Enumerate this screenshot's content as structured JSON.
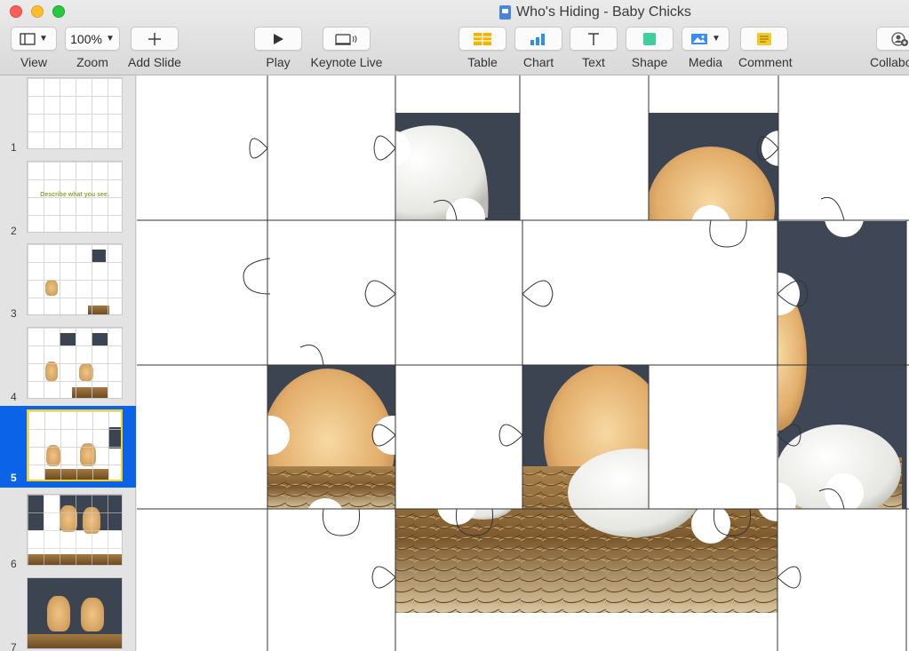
{
  "window": {
    "title": "Who's Hiding - Baby Chicks"
  },
  "toolbar": {
    "view_label": "View",
    "zoom_value": "100%",
    "zoom_label": "Zoom",
    "add_slide_label": "Add Slide",
    "play_label": "Play",
    "keynote_live_label": "Keynote Live",
    "table_label": "Table",
    "chart_label": "Chart",
    "text_label": "Text",
    "shape_label": "Shape",
    "media_label": "Media",
    "comment_label": "Comment",
    "collaborate_label": "Collabo"
  },
  "sidebar": {
    "slides": [
      {
        "number": "1"
      },
      {
        "number": "2",
        "text": "Describe what you see."
      },
      {
        "number": "3"
      },
      {
        "number": "4"
      },
      {
        "number": "5",
        "selected": true
      },
      {
        "number": "6"
      },
      {
        "number": "7"
      }
    ]
  },
  "colors": {
    "selection": "#0b63e8",
    "thumb_highlight": "#f7d31a",
    "photo_background": "#3c4452",
    "chick": "#e8b877",
    "nest": "#8a6232"
  }
}
